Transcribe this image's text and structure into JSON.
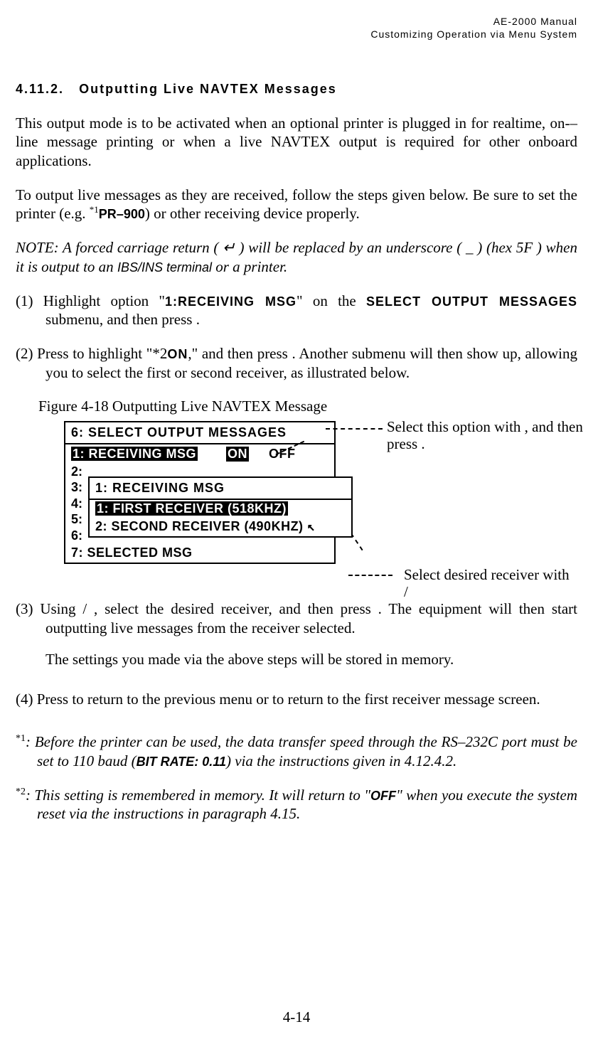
{
  "header": {
    "line1": "AE-2000 Manual",
    "line2": "Customizing Operation via Menu System"
  },
  "section": {
    "number": "4.11.2.",
    "title": "Outputting Live NAVTEX Messages"
  },
  "paragraphs": {
    "p1": "This output mode is to be activated when an optional printer is plugged in for realtime, on-–line message printing or when a live NAVTEX output is required for other onboard applications.",
    "p2a": "To output live messages as they are received, follow the steps given below. Be sure to set the printer (e.g. ",
    "p2_sup": "*1",
    "p2_bold": "PR–900",
    "p2b": ") or other receiving device properly.",
    "note_a": "NOTE: A forced carriage return ( ↵ ) will be replaced by an underscore ( _ ) (hex 5F ) when it is output to an ",
    "note_mid": "IBS/INS terminal",
    "note_b": " or a printer."
  },
  "steps": {
    "s1_a": "(1) Highlight option \"",
    "s1_opt": "1:RECEIVING MSG",
    "s1_b": "\" on the ",
    "s1_menu": "SELECT OUTPUT MESSAGES",
    "s1_c": " submenu, and then press        .",
    "s2_a": "(2) Press      to highlight \"",
    "s2_sup": "*2",
    "s2_on": "ON",
    "s2_b": ",\" and then press       .   Another submenu will then show up, allowing you to select the first or second receiver, as illustrated below.",
    "s3_a": "(3) Using      /     , select the desired receiver, and then press       . The equipment will then start outputting live messages from the receiver selected.",
    "s3_note": "The settings you made via the above steps will be stored in memory.",
    "s4": "(4) Press       to return to the previous menu or       to return to the first receiver message screen."
  },
  "figure": {
    "caption": "Figure 4-18   Outputting Live NAVTEX Message",
    "menu1_title": "6: SELECT OUTPUT MESSAGES",
    "menu1_row": {
      "label": "1: RECEIVING MSG",
      "on": "ON",
      "off": "OFF"
    },
    "hidden": [
      "2:",
      "3:",
      "4:",
      "5:",
      "6:"
    ],
    "menu1_last": "7: SELECTED MSG",
    "menu2_title": "1: RECEIVING MSG",
    "menu2_opts": [
      "1: FIRST RECEIVER (518KHZ)",
      "2: SECOND RECEIVER (490KHZ)"
    ],
    "menu2_cursor": "↖",
    "callout_top": "Select this option with      , and then press       .",
    "callout_bot_a": "Select desired receiver with",
    "callout_bot_b": "      /"
  },
  "footnotes": {
    "f1_tag": "*1",
    "f1_a": ": Before the printer can be used, the data transfer speed through the RS–232C port must be set to 110 baud (",
    "f1_bold": "BIT RATE: 0.11",
    "f1_b": ") via the instructions given in 4.12.4.2.",
    "f2_tag": "*2",
    "f2_a": ": This setting is remembered in memory. It will return to \"",
    "f2_bold": "OFF",
    "f2_b": "\" when you execute the system reset via the instructions in paragraph 4.15."
  },
  "page_number": "4-14"
}
